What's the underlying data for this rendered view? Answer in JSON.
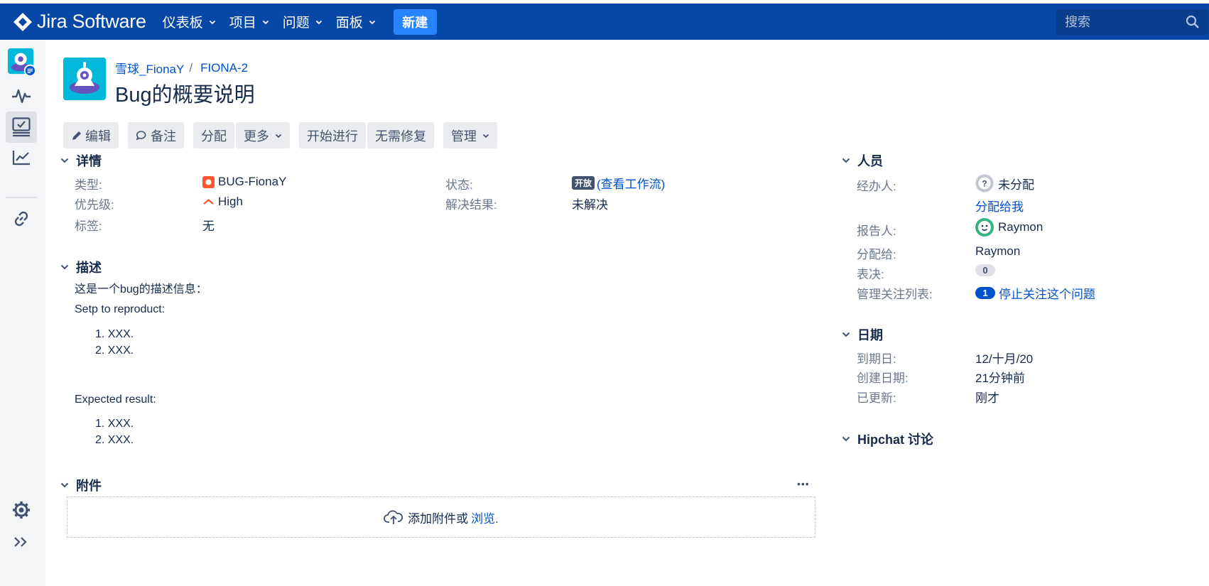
{
  "app": {
    "title": "Jira Software",
    "create_label": "新建",
    "search_placeholder": "搜索"
  },
  "topnav": [
    {
      "label": "仪表板"
    },
    {
      "label": "项目"
    },
    {
      "label": "问题"
    },
    {
      "label": "面板"
    }
  ],
  "sidebar": {
    "icons": [
      "project-avatar-icon",
      "activity-icon",
      "board-icon",
      "reports-icon",
      "link-icon",
      "gear-icon",
      "expand-icon"
    ]
  },
  "breadcrumb": {
    "project": "雪球_FionaY",
    "sep": "/",
    "issue_key": "FIONA-2"
  },
  "issue": {
    "title": "Bug的概要说明"
  },
  "toolbar": {
    "edit": "编辑",
    "comment": "备注",
    "assign": "分配",
    "more": "更多",
    "start": "开始进行",
    "wontfix": "无需修复",
    "admin": "管理"
  },
  "details": {
    "heading": "详情",
    "type_label": "类型:",
    "type_value": "BUG-FionaY",
    "priority_label": "优先级:",
    "priority_value": "High",
    "labels_label": "标签:",
    "labels_value": "无",
    "status_label": "状态:",
    "status_lozenge": "开放",
    "status_link": "(查看工作流)",
    "resolution_label": "解决结果:",
    "resolution_value": "未解决"
  },
  "description": {
    "heading": "描述",
    "intro": "这是一个bug的描述信息：",
    "steps_title": "Setp to reproduct:",
    "steps": [
      "1. XXX.",
      "2. XXX."
    ],
    "expected_title": "Expected result:",
    "expected": [
      "1. XXX.",
      "2. XXX."
    ]
  },
  "attachments": {
    "heading": "附件",
    "more": "•••",
    "drop_text": "添加附件或",
    "browse": "浏览."
  },
  "people": {
    "heading": "人员",
    "assignee_label": "经办人:",
    "assignee_value": "未分配",
    "assign_to_me": "分配给我",
    "reporter_label": "报告人:",
    "reporter_value": "Raymon",
    "assigned_label": "分配给:",
    "assigned_value": "Raymon",
    "votes_label": "表决:",
    "votes_value": "0",
    "watchers_label": "管理关注列表:",
    "watchers_count": "1",
    "watchers_link": "停止关注这个问题"
  },
  "dates": {
    "heading": "日期",
    "due_label": "到期日:",
    "due_value": "12/十月/20",
    "created_label": "创建日期:",
    "created_value": "21分钟前",
    "updated_label": "已更新:",
    "updated_value": "刚才"
  },
  "hipchat": {
    "heading": "Hipchat 讨论"
  },
  "colors": {
    "nav": "#0747a6",
    "create": "#2684ff",
    "link": "#0052cc",
    "priority_high": "#ff5630",
    "bug": "#ff5630"
  }
}
